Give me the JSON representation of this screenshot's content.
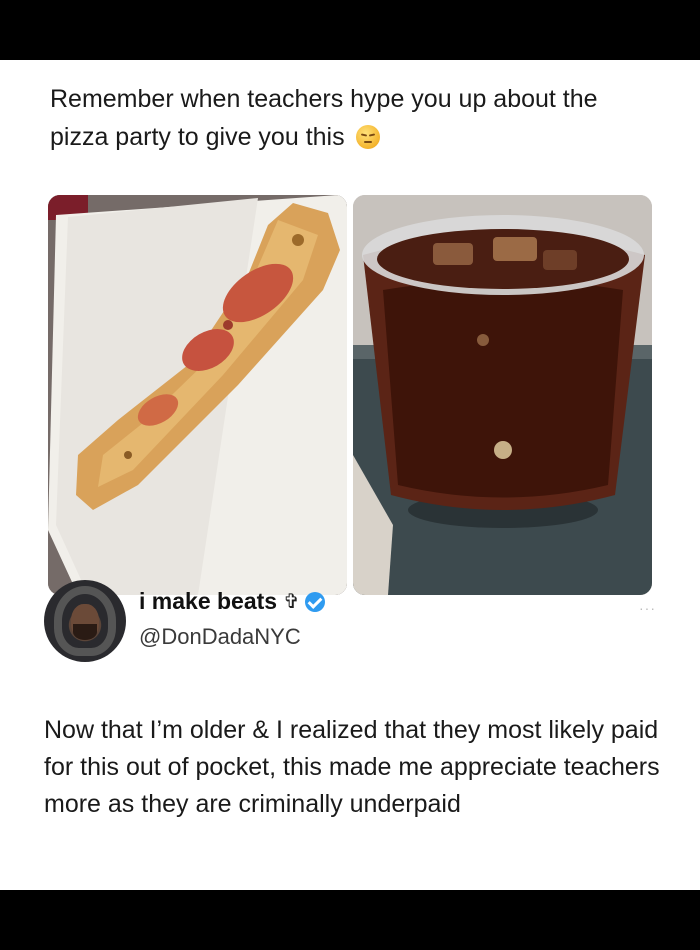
{
  "post": {
    "quote_text": "Remember when teachers hype you up about the pizza party to give you this",
    "quote_emoji": "pensive-face-emoji",
    "images": [
      {
        "name": "pizza-slice-image"
      },
      {
        "name": "soda-cup-image"
      }
    ]
  },
  "author": {
    "name": "i make beats",
    "symbol": "✞",
    "handle": "@DonDadaNYC",
    "verified": true,
    "more_label": "···"
  },
  "tweet": {
    "text": "Now that I’m older & I realized that they most likely paid for this out of pocket, this made me appreciate teachers more as they are criminally underpaid"
  },
  "colors": {
    "background": "#000000",
    "card": "#ffffff",
    "verified": "#2f9bf0"
  }
}
